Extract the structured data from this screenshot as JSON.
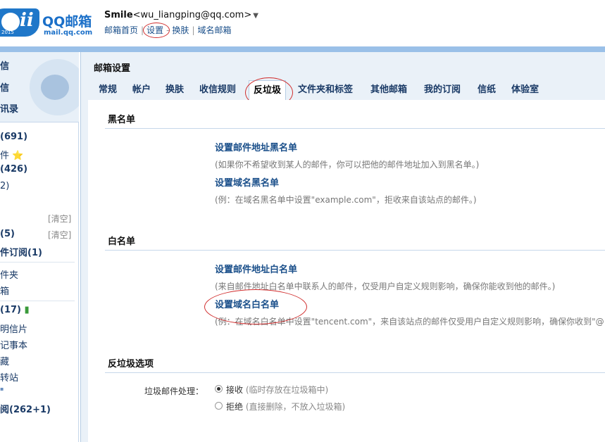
{
  "header": {
    "logo_title": "QQ邮箱",
    "logo_domain": "mail.qq.com",
    "logo_year": "2015",
    "user_name": "Smile",
    "user_email": "<wu_liangping@qq.com>",
    "links": [
      "邮箱首页",
      "设置",
      "换肤",
      "域名邮箱"
    ]
  },
  "leftnav": {
    "top_items": [
      "信",
      "信",
      "讯录"
    ],
    "folders": [
      {
        "label": "(691)",
        "bold": true
      },
      {
        "label": "件 ⭐",
        "bold": false
      },
      {
        "label": "(426)",
        "bold": true
      },
      {
        "label": "2)",
        "bold": false
      },
      {
        "label": "(5)",
        "bold": true
      },
      {
        "label": "件订阅(1)",
        "bold": true
      },
      {
        "label": "件夹",
        "bold": false
      },
      {
        "label": "箱",
        "bold": false
      },
      {
        "label": "(17)",
        "bold": true
      },
      {
        "label": "明信片",
        "bold": false
      },
      {
        "label": "记事本",
        "bold": false
      },
      {
        "label": "藏",
        "bold": false
      },
      {
        "label": "转站",
        "bold": false
      },
      {
        "label": "阅(262+1)",
        "bold": true
      }
    ],
    "clear_label": "[清空]"
  },
  "main": {
    "title": "邮箱设置",
    "tabs": [
      "常规",
      "帐户",
      "换肤",
      "收信规则",
      "反垃圾",
      "文件夹和标签",
      "其他邮箱",
      "我的订阅",
      "信纸",
      "体验室"
    ],
    "active_tab": "反垃圾"
  },
  "blacklist": {
    "title": "黑名单",
    "addr_link": "设置邮件地址黑名单",
    "addr_desc": "(如果你不希望收到某人的邮件，你可以把他的邮件地址加入到黑名单。)",
    "domain_link": "设置域名黑名单",
    "domain_desc": "(例：在域名黑名单中设置\"example.com\"，拒收来自该站点的邮件。)"
  },
  "whitelist": {
    "title": "白名单",
    "addr_link": "设置邮件地址白名单",
    "addr_desc": "(来自邮件地址白名单中联系人的邮件，仅受用户自定义规则影响，确保你能收到他的邮件。)",
    "domain_link": "设置域名白名单",
    "domain_desc": "(例：在域名白名单中设置\"tencent.com\"，来自该站点的邮件仅受用户自定义规则影响，确保你收到\"@"
  },
  "antispam": {
    "title": "反垃圾选项",
    "label": "垃圾邮件处理：",
    "accept": "接收",
    "accept_note": "(临时存放在垃圾箱中)",
    "reject": "拒绝",
    "reject_note": "(直接删除，不放入垃圾箱)"
  },
  "colors": {
    "accent": "#1a6fc8",
    "annotation": "#d12f2f",
    "bar": "#9ac0e8"
  }
}
